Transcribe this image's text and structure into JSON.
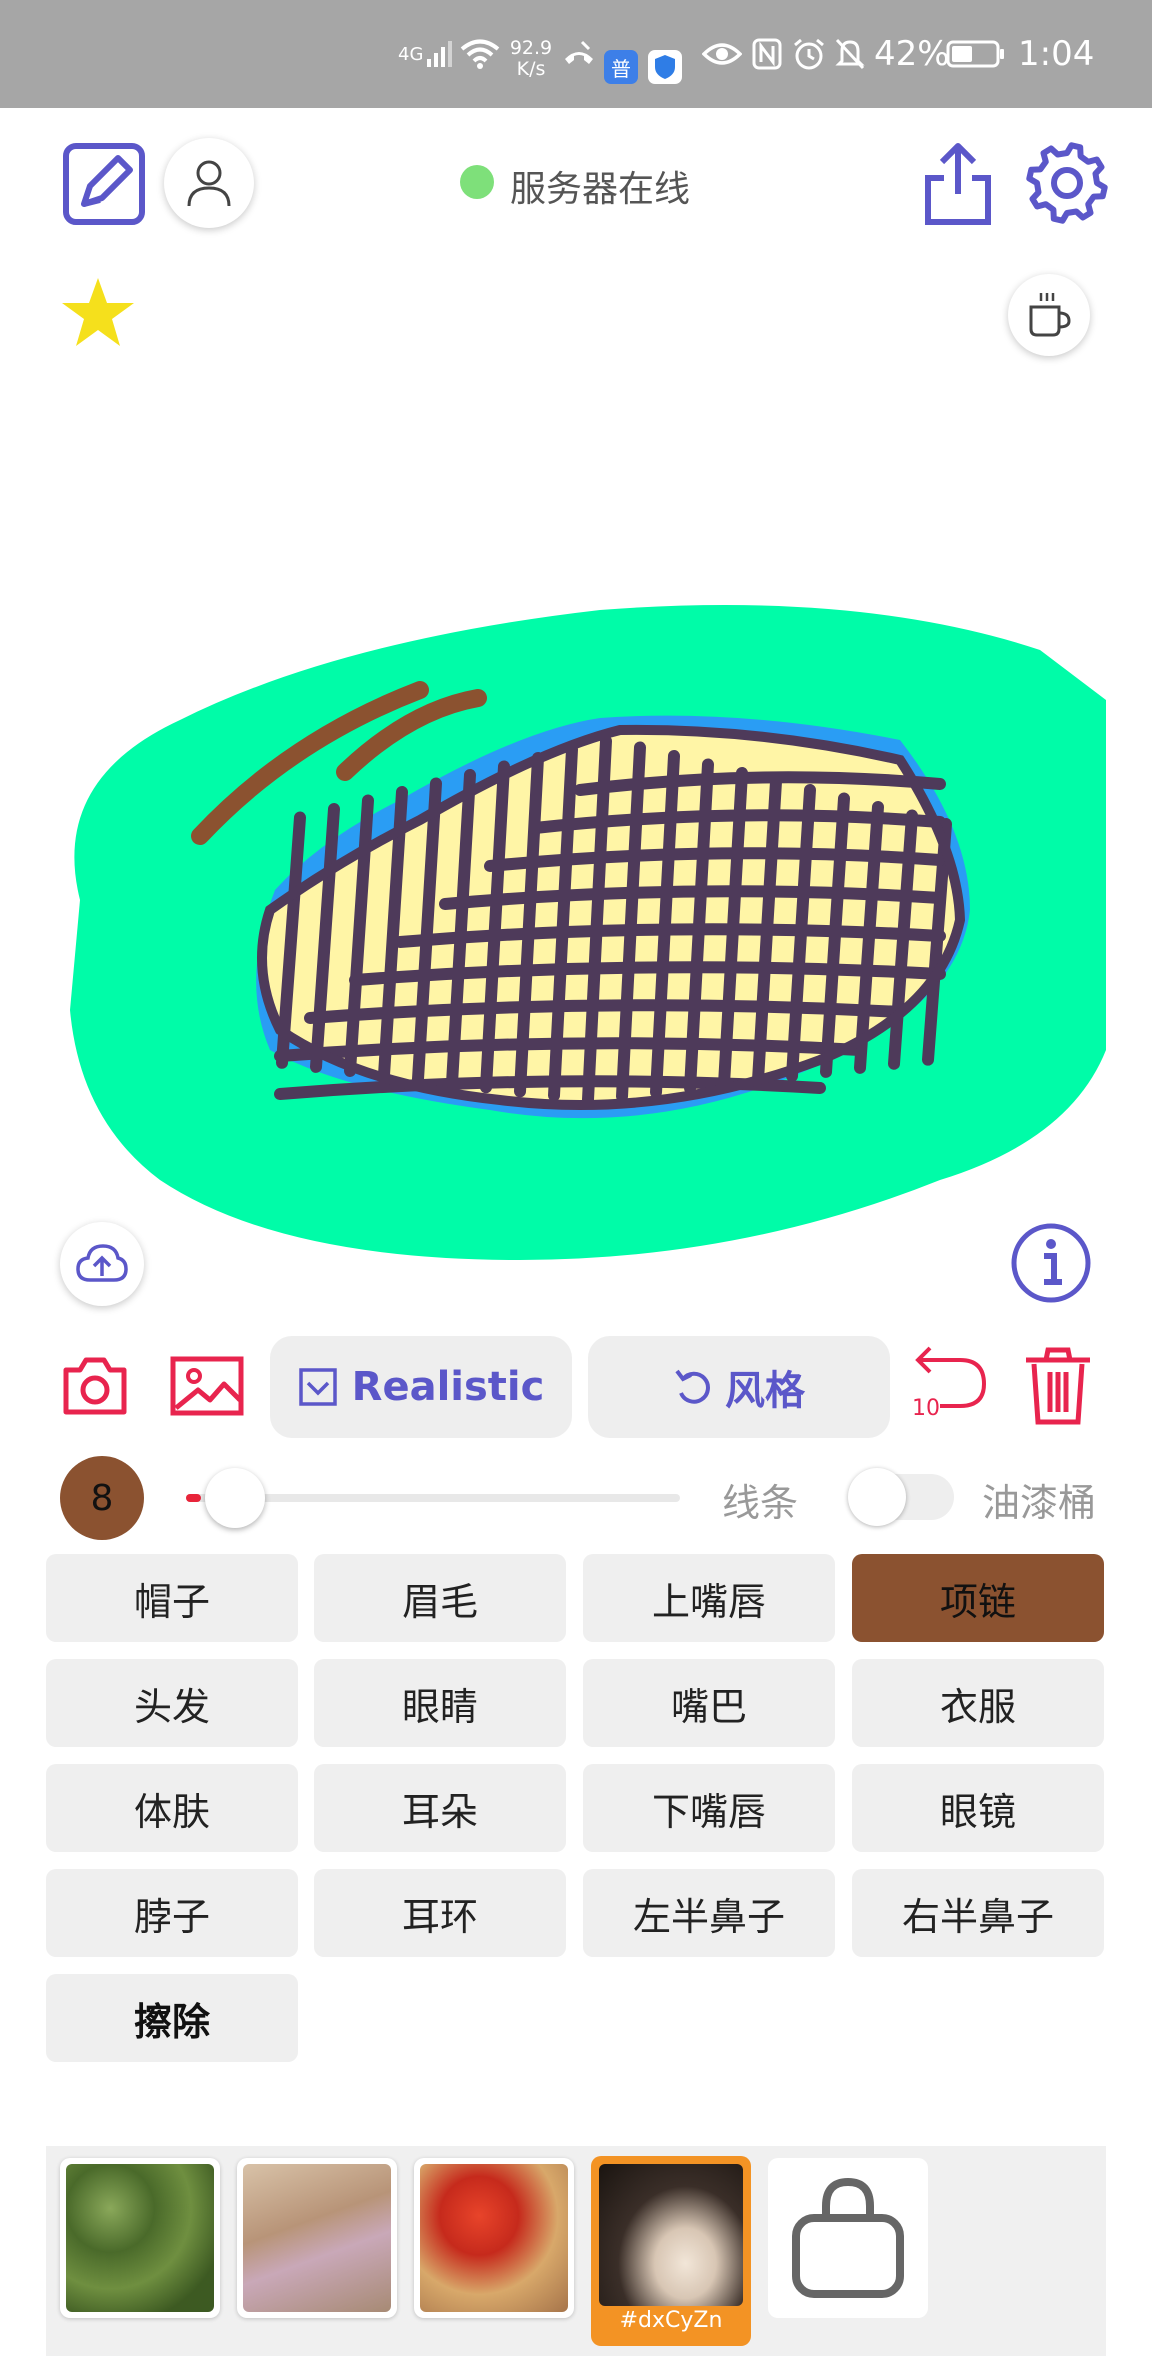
{
  "status_bar": {
    "network": "4G",
    "speed_value": "92.9",
    "speed_unit": "K/s",
    "battery": "42%",
    "time": "1:04",
    "badge_label": "普"
  },
  "header": {
    "server_status": "服务器在线",
    "server_status_color": "#7ee07a",
    "accent": "#5b57c9"
  },
  "toolbar": {
    "realistic_label": "Realistic",
    "style_label": "风格",
    "undo_count": "10",
    "danger_color": "#e8244e"
  },
  "brush": {
    "size": "8",
    "size_bubble_color": "#8b5230",
    "slider_level": 0.1,
    "line_label": "线条",
    "bucket_label": "油漆桶",
    "bucket_enabled": false
  },
  "labels": [
    {
      "text": "帽子"
    },
    {
      "text": "眉毛"
    },
    {
      "text": "上嘴唇"
    },
    {
      "text": "项链",
      "active": true
    },
    {
      "text": "头发"
    },
    {
      "text": "眼睛"
    },
    {
      "text": "嘴巴"
    },
    {
      "text": "衣服"
    },
    {
      "text": "体肤"
    },
    {
      "text": "耳朵"
    },
    {
      "text": "下嘴唇"
    },
    {
      "text": "眼镜"
    },
    {
      "text": "脖子"
    },
    {
      "text": "耳环"
    },
    {
      "text": "左半鼻子"
    },
    {
      "text": "右半鼻子"
    },
    {
      "text": "擦除"
    }
  ],
  "canvas_colors": {
    "background_shape": "#00fca8",
    "stroke_brown": "#8b5230",
    "fill_yellow": "#fff5a6",
    "fill_blue": "#2a9df4",
    "grid_purple": "#4e3a5a"
  },
  "gallery": {
    "selected_label": "#dxCyZn",
    "selected_border": "#f39324",
    "store_icon": "shopping-bag-icon"
  }
}
